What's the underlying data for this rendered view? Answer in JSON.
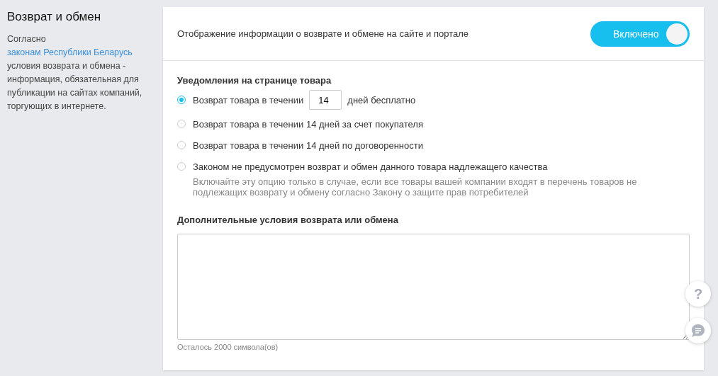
{
  "sidebar": {
    "title": "Возврат и обмен",
    "text_before": "Согласно ",
    "link": "законам Республики Беларусь",
    "text_after": " условия возврата и обмена - информация, обязательная для публикации на сайтах компаний, торгующих в интернете."
  },
  "display": {
    "label": "Отображение информации о возврате и обмене на сайте и портале",
    "toggle": {
      "label": "Включено",
      "on": true
    }
  },
  "notifications": {
    "title": "Уведомления на странице товара",
    "options": [
      {
        "kind": "days",
        "selected": true,
        "before": "Возврат товара в течении",
        "value": "14",
        "after": "дней бесплатно"
      },
      {
        "kind": "plain",
        "selected": false,
        "label": "Возврат товара в течении 14 дней за счет покупателя"
      },
      {
        "kind": "plain",
        "selected": false,
        "label": "Возврат товара в течении 14 дней по договоренности"
      },
      {
        "kind": "plain",
        "selected": false,
        "label": "Законом не предусмотрен возврат и обмен данного товара надлежащего качества",
        "hint": "Включайте эту опцию только в случае, если все товары вашей компании входят в перечень товаров не подлежащих возврату и обмену согласно Закону о защите прав потребителей"
      }
    ]
  },
  "extra": {
    "title": "Дополнительные условия возврата или обмена",
    "counter": "Осталось 2000 символа(ов)"
  },
  "help_button": {
    "label": "?"
  }
}
